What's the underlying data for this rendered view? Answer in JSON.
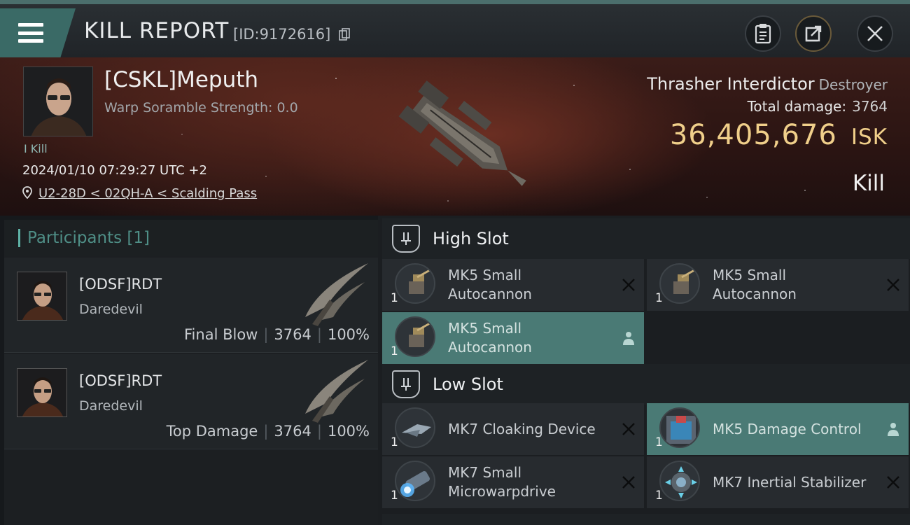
{
  "header": {
    "title": "KILL REPORT",
    "report_id": "[ID:9172616]"
  },
  "victim": {
    "name": "[CSKL]Meputh",
    "scramble": "Warp Soramble Strength: 0.0",
    "kill_tag": "I Kill",
    "datetime": "2024/01/10 07:29:27 UTC +2",
    "location": "U2-28D < 02QH-A < Scalding Pass"
  },
  "ship": {
    "name": "Thrasher Interdictor",
    "class": "Destroyer",
    "total_damage_label": "Total damage:",
    "total_damage": "3764",
    "isk_value": "36,405,676",
    "isk_unit": "ISK",
    "result": "Kill"
  },
  "participants": {
    "title": "Participants [1]",
    "rows": [
      {
        "name": "[ODSF]RDT",
        "ship": "Daredevil",
        "role": "Final Blow",
        "damage": "3764",
        "percent": "100%"
      },
      {
        "name": "[ODSF]RDT",
        "ship": "Daredevil",
        "role": "Top Damage",
        "damage": "3764",
        "percent": "100%"
      }
    ]
  },
  "fittings": {
    "high_slot_title": "High Slot",
    "low_slot_title": "Low Slot",
    "high": [
      {
        "name": "MK5 Small Autocannon",
        "qty": "1",
        "state": "destroyed"
      },
      {
        "name": "MK5 Small Autocannon",
        "qty": "1",
        "state": "destroyed"
      },
      {
        "name": "MK5 Small Autocannon",
        "qty": "1",
        "state": "dropped"
      }
    ],
    "low": [
      {
        "name": "MK7 Cloaking Device",
        "qty": "1",
        "state": "destroyed"
      },
      {
        "name": "MK5 Damage Control",
        "qty": "1",
        "state": "dropped"
      },
      {
        "name": "MK7 Small Microwarpdrive",
        "qty": "1",
        "state": "destroyed"
      },
      {
        "name": "MK7 Inertial Stabilizer",
        "qty": "1",
        "state": "destroyed"
      }
    ]
  },
  "colors": {
    "accent_teal": "#4a7a75",
    "isk_gold": "#f0cf8a"
  }
}
